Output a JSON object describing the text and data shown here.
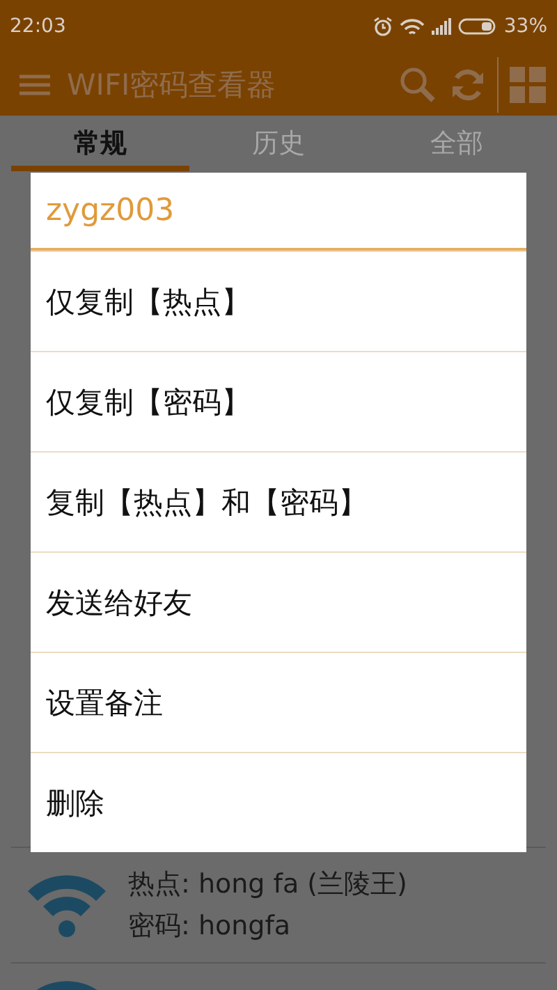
{
  "status_bar": {
    "time": "22:03",
    "battery": "33%"
  },
  "app_bar": {
    "title": "WIFI密码查看器"
  },
  "tabs": [
    {
      "label": "常规",
      "selected": true
    },
    {
      "label": "历史",
      "selected": false
    },
    {
      "label": "全部",
      "selected": false
    }
  ],
  "list": [
    {
      "hotspot": "热点: hong fa (兰陵王)",
      "password": "密码: hongfa"
    }
  ],
  "dialog": {
    "title": "zygz003",
    "items": [
      "仅复制【热点】",
      "仅复制【密码】",
      "复制【热点】和【密码】",
      "发送给好友",
      "设置备注",
      "删除"
    ]
  }
}
